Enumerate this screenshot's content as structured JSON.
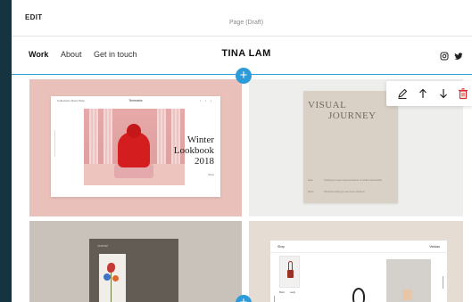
{
  "editor": {
    "edit_label": "EDIT",
    "status": "Page (Draft)"
  },
  "nav": {
    "items": [
      "Work",
      "About",
      "Get in touch"
    ],
    "brand": "TINA LAM",
    "social_icons": [
      "instagram-icon",
      "twitter-icon"
    ]
  },
  "colors": {
    "accent": "#2d9bd8",
    "delete": "#d92b2b",
    "frame_bg": "#15343f"
  },
  "tiles": [
    {
      "name": "winter-lookbook",
      "mock_title": "Tenmarks",
      "mock_nav": "Collections  About  Shop",
      "headline": [
        "Winter",
        "Lookbook",
        "2018"
      ],
      "tag": "Shop"
    },
    {
      "name": "visual-journey",
      "title_line1": "VISUAL",
      "title_line2": "JOURNEY",
      "rows": [
        {
          "label": "Idea",
          "text": "Sharing an open representation of what's achievable"
        },
        {
          "label": "Work",
          "text": "Physical testing to see best solutions"
        }
      ]
    },
    {
      "name": "journal",
      "label": "Journal"
    },
    {
      "name": "shop",
      "shop_label": "Shop",
      "brand": "Veddas",
      "item1": "Bold",
      "item2": "Lady"
    }
  ],
  "toolbar": [
    "edit-pencil-icon",
    "move-up-icon",
    "move-down-icon",
    "delete-icon"
  ]
}
